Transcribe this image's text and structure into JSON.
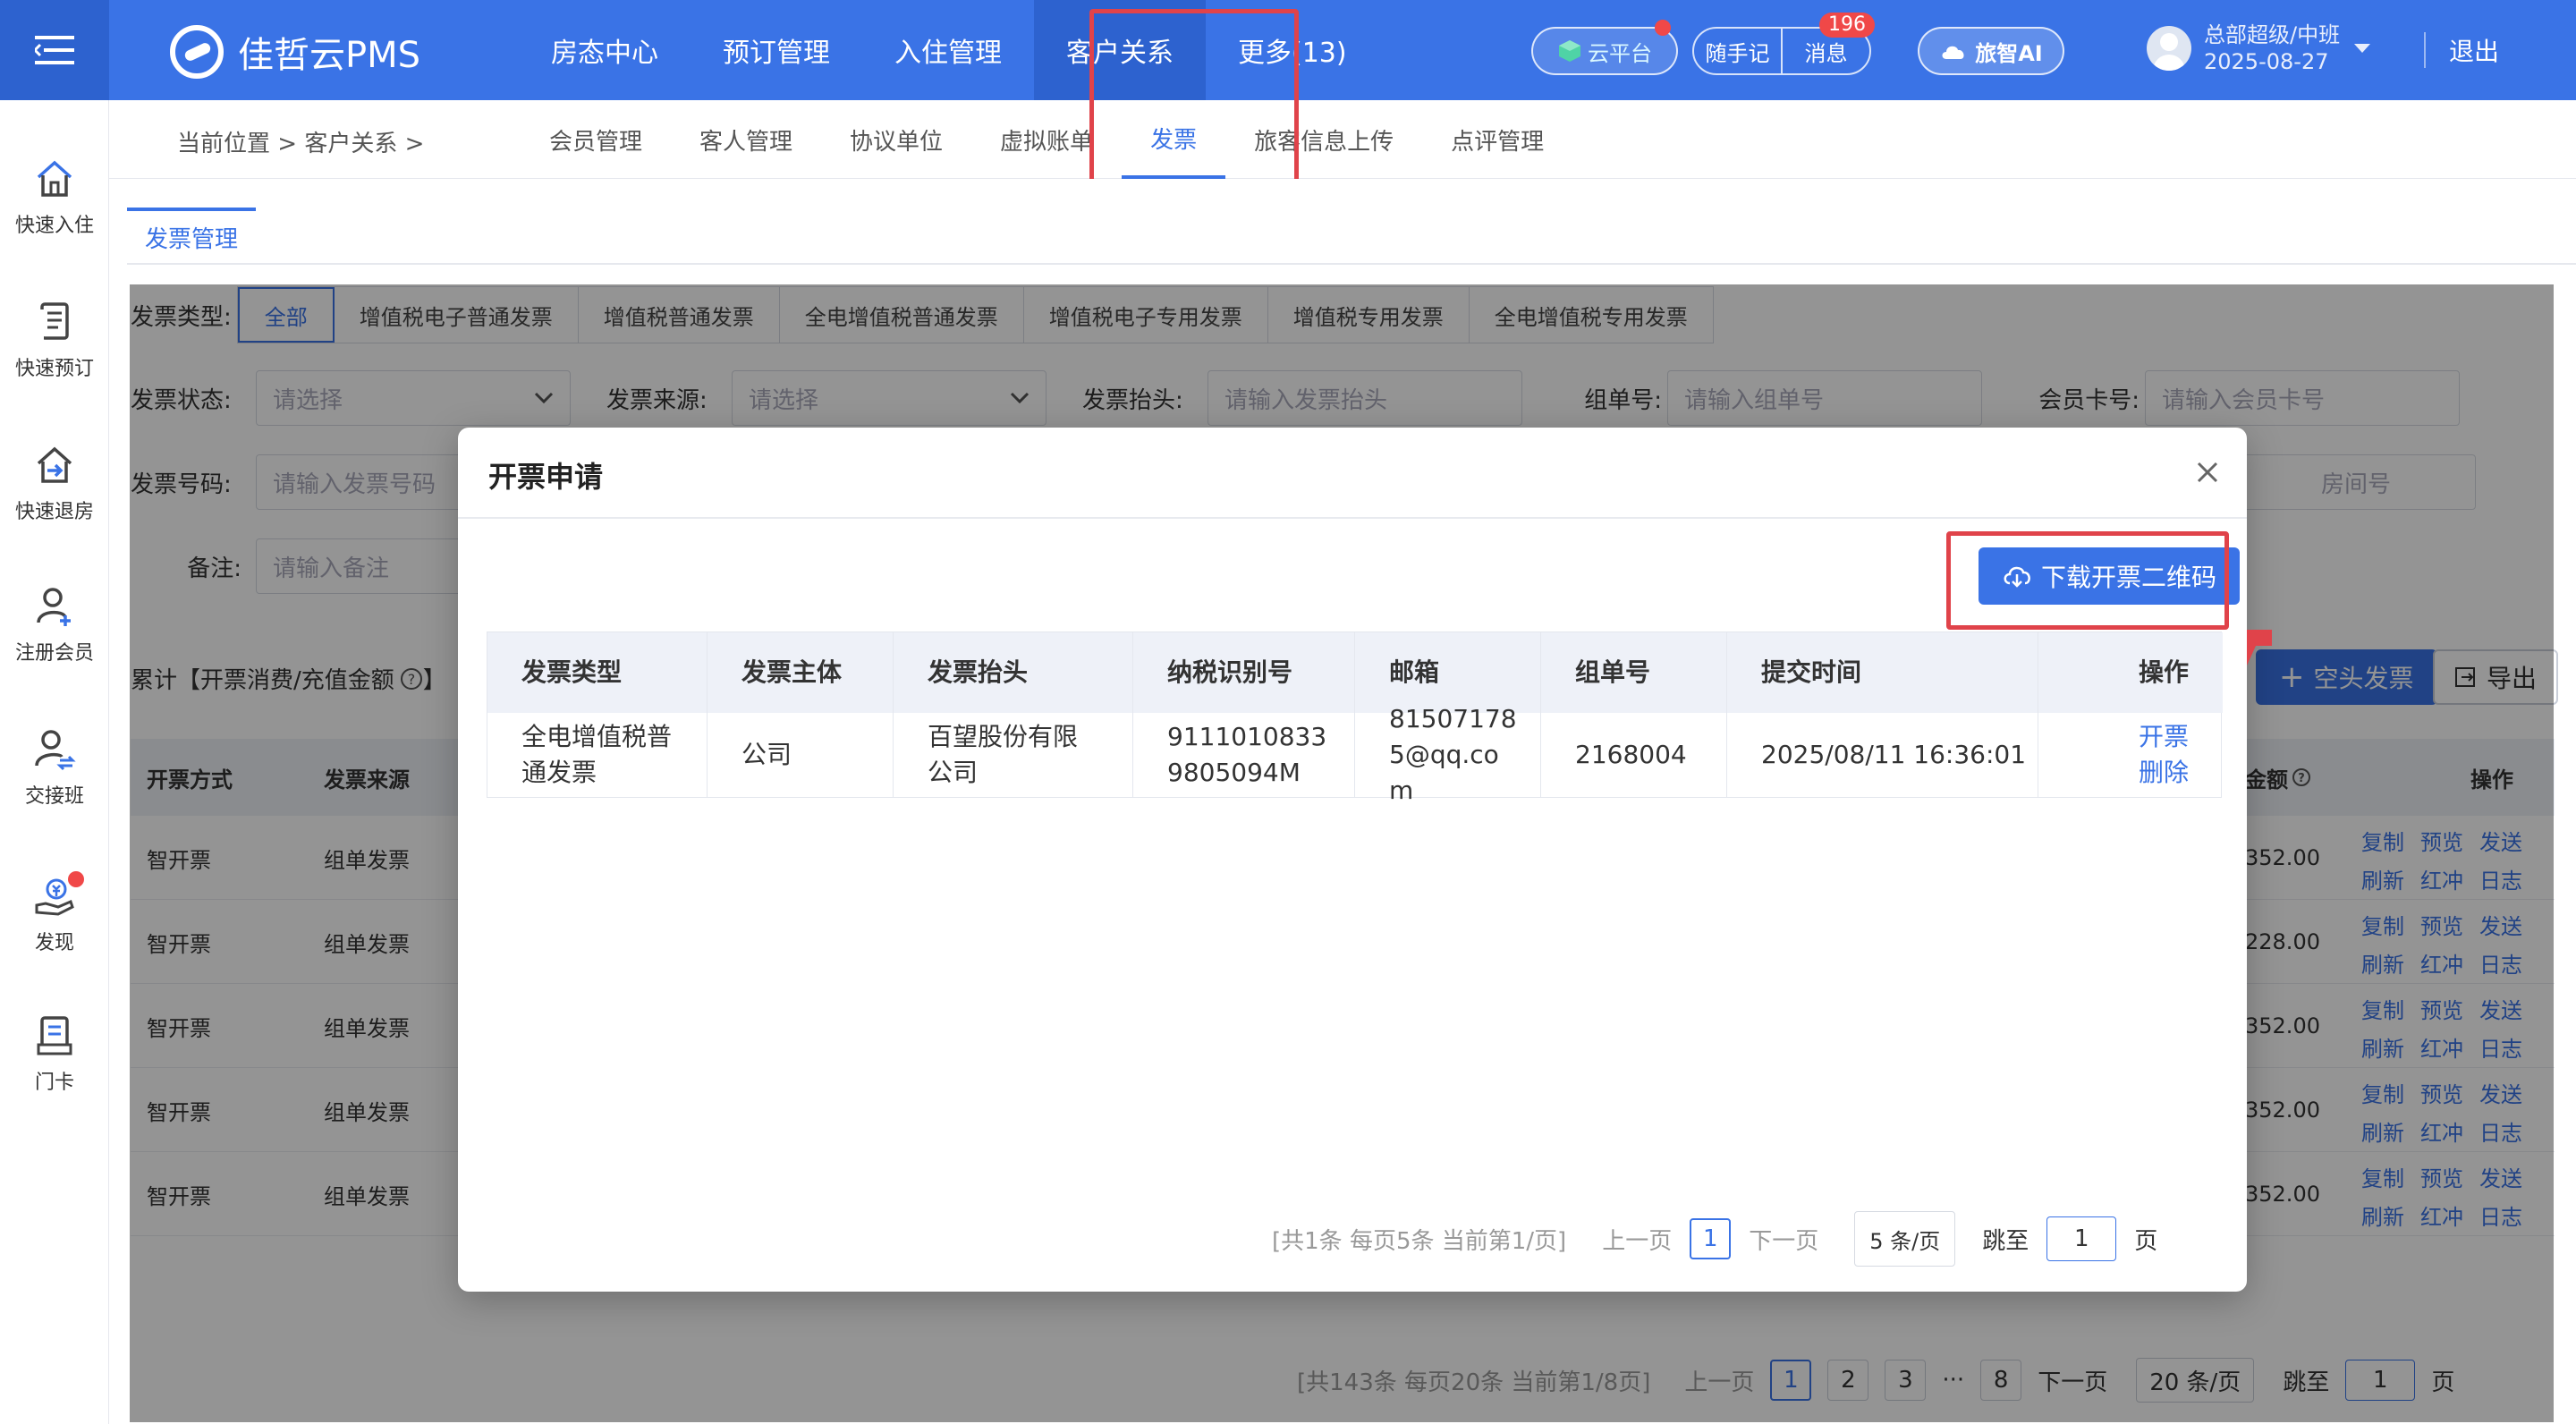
{
  "header": {
    "brand": "佳哲云PMS",
    "nav": [
      "房态中心",
      "预订管理",
      "入住管理",
      "客户关系",
      "更多(13)"
    ],
    "active_nav": "客户关系",
    "cloud_platform": "云平台",
    "memo": "随手记",
    "messages": "消息",
    "messages_badge": "196",
    "ai": "旅智AI",
    "user_role": "总部超级/中班",
    "user_date": "2025-08-27",
    "logout": "退出",
    "accent_color": "#3a73e6"
  },
  "sidebar": {
    "items": [
      {
        "label": "快速入住",
        "icon": "home-icon"
      },
      {
        "label": "快速预订",
        "icon": "document-icon"
      },
      {
        "label": "快速退房",
        "icon": "checkout-icon"
      },
      {
        "label": "注册会员",
        "icon": "add-user-icon"
      },
      {
        "label": "交接班",
        "icon": "shift-icon"
      },
      {
        "label": "发现",
        "icon": "money-hand-icon"
      },
      {
        "label": "门卡",
        "icon": "card-icon"
      }
    ]
  },
  "subnav": {
    "breadcrumb": "当前位置 >  客户关系  >",
    "tabs": [
      "会员管理",
      "客人管理",
      "协议单位",
      "虚拟账单",
      "发票",
      "旅客信息上传",
      "点评管理"
    ],
    "active": "发票"
  },
  "content": {
    "tab": "发票管理",
    "filters": {
      "type_label": "发票类型:",
      "types": [
        "全部",
        "增值税电子普通发票",
        "增值税普通发票",
        "全电增值税普通发票",
        "增值税电子专用发票",
        "增值税专用发票",
        "全电增值税专用发票"
      ],
      "status_label": "发票状态:",
      "status_placeholder": "请选择",
      "source_label": "发票来源:",
      "source_placeholder": "请选择",
      "title_label": "发票抬头:",
      "title_placeholder": "请输入发票抬头",
      "group_label": "组单号:",
      "group_placeholder": "请输入组单号",
      "member_label": "会员卡号:",
      "member_placeholder": "请输入会员卡号",
      "number_label": "发票号码:",
      "number_placeholder": "请输入发票号码",
      "room_placeholder_partial": "房间号",
      "remark_label": "备注:",
      "remark_placeholder": "请输入备注"
    },
    "summary": "累计【开票消费/充值金额",
    "buttons": {
      "blank_invoice": "空头发票",
      "export": "导出"
    },
    "table": {
      "headers": [
        "开票方式",
        "发票来源"
      ],
      "amount_header": "金额",
      "ops_header": "操作",
      "rows": [
        {
          "method": "智开票",
          "source": "组单发票",
          "amount": "352.00"
        },
        {
          "method": "智开票",
          "source": "组单发票",
          "amount": "228.00"
        },
        {
          "method": "智开票",
          "source": "组单发票",
          "amount": "352.00"
        },
        {
          "method": "智开票",
          "source": "组单发票",
          "amount": "352.00"
        },
        {
          "method": "智开票",
          "source": "组单发票",
          "amount": "352.00"
        }
      ],
      "ops": [
        "复制",
        "预览",
        "发送",
        "刷新",
        "红冲",
        "日志"
      ]
    },
    "pager": {
      "summary": "[共143条 每页20条 当前第1/8页]",
      "prev": "上一页",
      "pages": [
        "1",
        "2",
        "3",
        "···",
        "8"
      ],
      "next": "下一页",
      "size": "20 条/页",
      "jump": "跳至",
      "jump_value": "1",
      "page_unit": "页"
    }
  },
  "modal": {
    "title": "开票申请",
    "download_button": "下载开票二维码",
    "headers": [
      "发票类型",
      "发票主体",
      "发票抬头",
      "纳税识别号",
      "邮箱",
      "组单号",
      "提交时间",
      "操作"
    ],
    "row": {
      "type": "全电增值税普通发票",
      "subject": "公司",
      "title": "百望股份有限公司",
      "tax_id": "91110108339805094M",
      "email": "815071785@qq.com",
      "group": "2168004",
      "time": "2025/08/11 16:36:01",
      "op_issue": "开票",
      "op_delete": "删除"
    },
    "pager": {
      "summary": "[共1条 每页5条 当前第1/页]",
      "prev": "上一页",
      "page": "1",
      "next": "下一页",
      "size": "5 条/页",
      "jump": "跳至",
      "jump_value": "1",
      "page_unit": "页"
    }
  }
}
